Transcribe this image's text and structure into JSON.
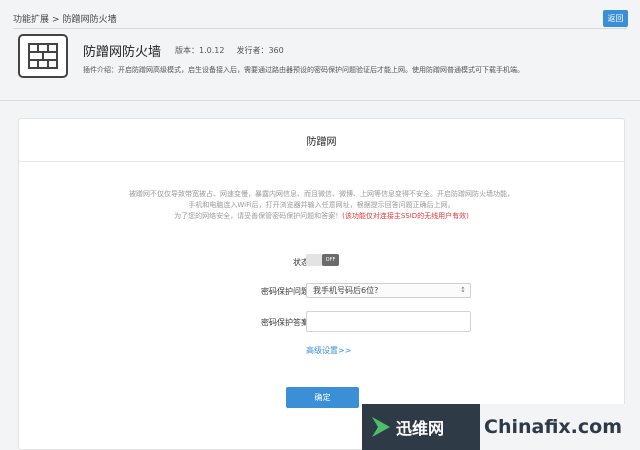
{
  "header": {
    "breadcrumb": [
      "功能扩展",
      "防蹭网防火墙"
    ],
    "breadcrumb_separator": ">",
    "back_label": "返回"
  },
  "plugin": {
    "icon": "firewall-icon",
    "title": "防蹭网防火墙",
    "version": "版本：1.0.12",
    "publisher": "发行者：360",
    "description": "插件介绍：开启防蹭网高级模式，启生设备接入后，需要通过路由器预设的密码保护问题验证后才能上网。使用防蹭网普通模式可下载手机端。"
  },
  "card": {
    "title": "防蹭网",
    "description_lines": [
      "被蹭网不仅仅导致带宽被占、网速变慢，暴露内网信息、而且微信、微博、上网等信息变得不安全。开启防蹭网防火墙功能，",
      "手机和电脑连入WiFi后，打开浏览器并输入任意网址，根据提示回答问题正确后上网。"
    ],
    "description_line3": "为了您的网络安全，请妥善保管密码保护问题和答案！",
    "description_warning": "(该功能仅对连接主SSID的无线用户有效)",
    "status_label": "状态",
    "toggle_text": "OFF",
    "question_label": "密码保护问题",
    "question_value": "我手机号码后6位?",
    "answer_label": "密码保护答案",
    "answer_value": "",
    "advanced_link": "高级设置>>",
    "confirm_label": "确定"
  },
  "watermark": {
    "logo_text": "迅维网",
    "site": "Chinafix.com"
  },
  "colors": {
    "accent": "#3b8fd6",
    "warning": "#e23a3a",
    "watermark_bg": "#2f3a47"
  }
}
